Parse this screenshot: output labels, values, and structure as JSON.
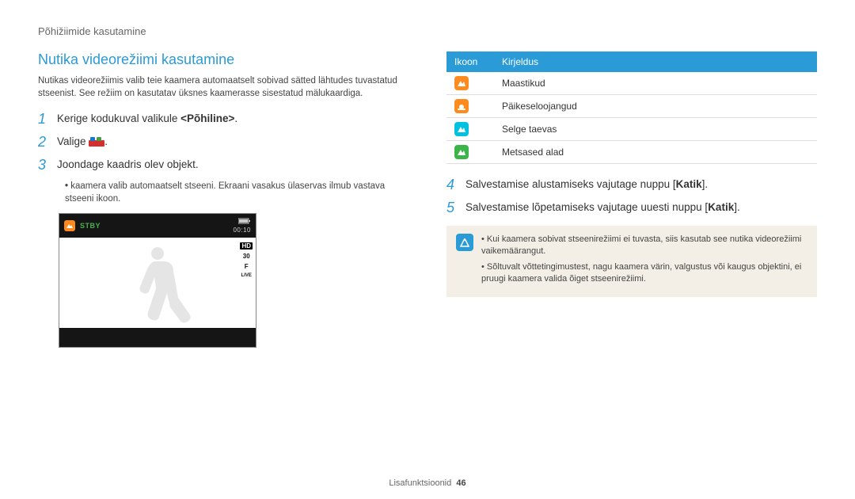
{
  "header": {
    "section": "Põhižiimide kasutamine"
  },
  "title": "Nutika videorežiimi kasutamine",
  "intro": "Nutikas videorežiimis valib teie kaamera automaatselt sobivad sätted lähtudes tuvastatud stseenist. See režiim on kasutatav üksnes kaamerasse sisestatud mälukaardiga.",
  "steps": [
    {
      "n": "1",
      "pre": "Kerige kodukuval valikule ",
      "bold": "<Põhiline>",
      "post": "."
    },
    {
      "n": "2",
      "pre": "Valige ",
      "bold": "",
      "post": ".",
      "icon": true
    },
    {
      "n": "3",
      "pre": "Joondage kaadris olev objekt.",
      "bold": "",
      "post": ""
    }
  ],
  "substep": "kaamera valib automaatselt stseeni. Ekraani vasakus ülaservas ilmub vastava stseeni ikoon.",
  "preview": {
    "stby": "STBY",
    "time": "00:10",
    "hd": "HD",
    "fps": "30",
    "f": "F",
    "live": "LIVE"
  },
  "table": {
    "headers": [
      "Ikoon",
      "Kirjeldus"
    ],
    "rows": [
      {
        "color": "orange",
        "icon": "mountain",
        "label": "Maastikud"
      },
      {
        "color": "orange",
        "icon": "sunset",
        "label": "Päikeseloojangud"
      },
      {
        "color": "cyan",
        "icon": "mountain",
        "label": "Selge taevas"
      },
      {
        "color": "green",
        "icon": "mountain",
        "label": "Metsased alad"
      }
    ]
  },
  "steps_right": [
    {
      "n": "4",
      "pre": "Salvestamise alustamiseks vajutage nuppu [",
      "bold": "Katik",
      "post": "]."
    },
    {
      "n": "5",
      "pre": "Salvestamise lõpetamiseks vajutage uuesti nuppu [",
      "bold": "Katik",
      "post": "]."
    }
  ],
  "notes": [
    "Kui kaamera sobivat stseenirežiimi ei tuvasta, siis kasutab see nutika videorežiimi vaikemäärangut.",
    "Sõltuvalt võttetingimustest, nagu kaamera värin, valgustus või kaugus objektini, ei pruugi kaamera valida õiget stseenirežiimi."
  ],
  "footer": {
    "label": "Lisafunktsioonid",
    "page": "46"
  }
}
